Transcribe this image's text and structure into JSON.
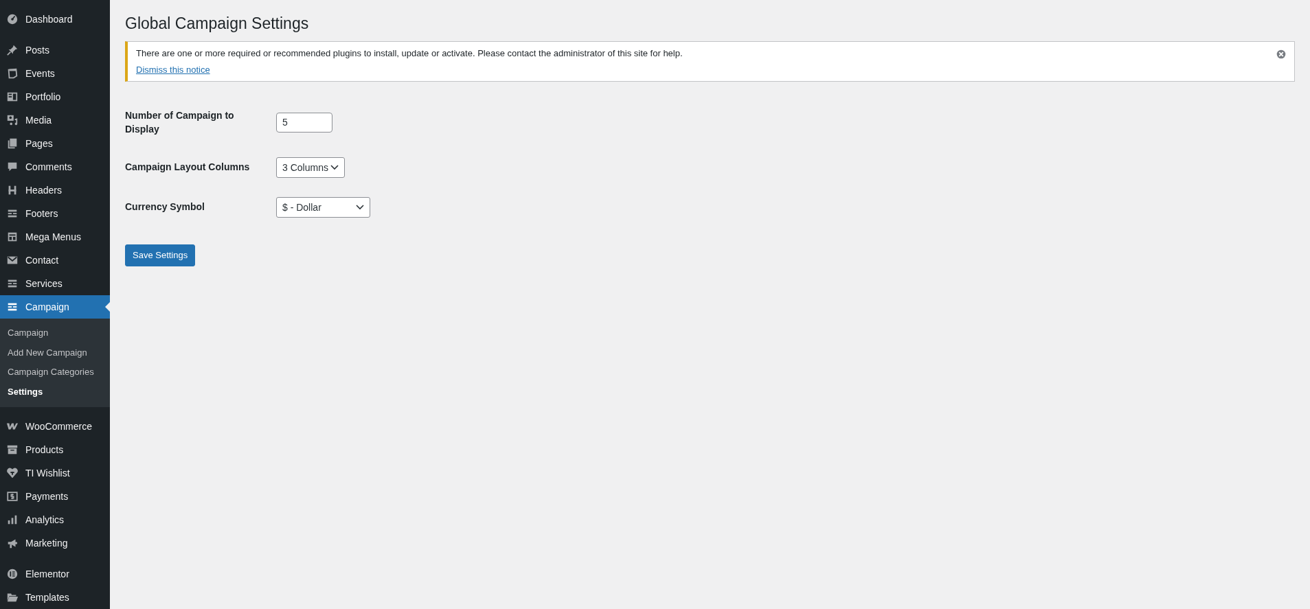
{
  "sidebar": {
    "sections": [
      [
        {
          "label": "Dashboard",
          "selected": false
        }
      ],
      [
        {
          "label": "Posts",
          "selected": false
        },
        {
          "label": "Events",
          "selected": false
        },
        {
          "label": "Portfolio",
          "selected": false
        },
        {
          "label": "Media",
          "selected": false
        },
        {
          "label": "Pages",
          "selected": false
        },
        {
          "label": "Comments",
          "selected": false
        },
        {
          "label": "Headers",
          "selected": false
        },
        {
          "label": "Footers",
          "selected": false
        },
        {
          "label": "Mega Menus",
          "selected": false
        },
        {
          "label": "Contact",
          "selected": false
        },
        {
          "label": "Services",
          "selected": false
        },
        {
          "label": "Campaign",
          "selected": true,
          "submenu": [
            {
              "label": "Campaign",
              "selected": false
            },
            {
              "label": "Add New Campaign",
              "selected": false
            },
            {
              "label": "Campaign Categories",
              "selected": false
            },
            {
              "label": "Settings",
              "selected": true
            }
          ]
        }
      ],
      [
        {
          "label": "WooCommerce",
          "selected": false
        },
        {
          "label": "Products",
          "selected": false
        },
        {
          "label": "TI Wishlist",
          "selected": false
        },
        {
          "label": "Payments",
          "selected": false
        },
        {
          "label": "Analytics",
          "selected": false
        },
        {
          "label": "Marketing",
          "selected": false
        }
      ],
      [
        {
          "label": "Elementor",
          "selected": false
        },
        {
          "label": "Templates",
          "selected": false
        }
      ]
    ]
  },
  "page": {
    "title": "Global Campaign Settings",
    "notice": {
      "message": "There are one or more required or recommended plugins to install, update or activate. Please contact the administrator of this site for help.",
      "link": "Dismiss this notice"
    },
    "fields": [
      {
        "kind": "number",
        "label": "Number of Campaign to Display",
        "value": "5"
      },
      {
        "kind": "select",
        "label": "Campaign Layout Columns",
        "value": "3 Columns"
      },
      {
        "kind": "select",
        "label": "Currency Symbol",
        "value": "$ - Dollar"
      }
    ],
    "save_button": "Save Settings"
  }
}
